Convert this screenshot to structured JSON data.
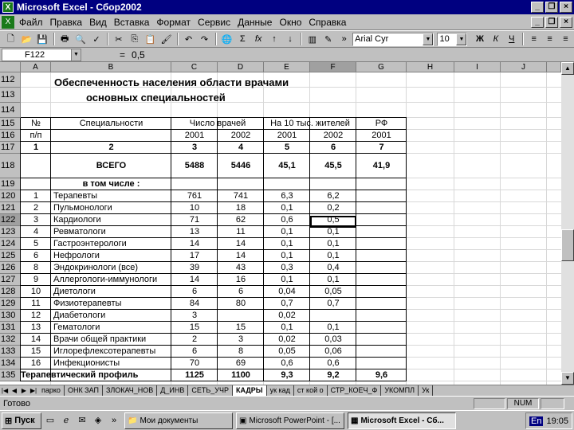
{
  "window": {
    "title": "Microsoft Excel - Сбор2002",
    "excel_icon_label": "X"
  },
  "menu": [
    "Файл",
    "Правка",
    "Вид",
    "Вставка",
    "Формат",
    "Сервис",
    "Данные",
    "Окно",
    "Справка"
  ],
  "toolbar": {
    "font": "Arial Cyr",
    "size": "10"
  },
  "formula": {
    "cell_ref": "F122",
    "eq": "=",
    "value": "0,5"
  },
  "columns": [
    "A",
    "B",
    "C",
    "D",
    "E",
    "F",
    "G",
    "H",
    "I",
    "J"
  ],
  "rows": [
    "112",
    "113",
    "114",
    "115",
    "116",
    "117",
    "118",
    "119",
    "120",
    "121",
    "122",
    "123",
    "124",
    "125",
    "126",
    "127",
    "128",
    "129",
    "130",
    "131",
    "132",
    "133",
    "134",
    "135"
  ],
  "title1": "Обеспеченность населения области врачами",
  "title2": "основных специальностей",
  "header": {
    "no": "№",
    "pp": "п/п",
    "spec": "Специальности",
    "count": "Число врачей",
    "per10k": "На 10 тыс. жителей",
    "rf": "РФ",
    "y2001": "2001",
    "y2002": "2002"
  },
  "colnums": [
    "1",
    "2",
    "3",
    "4",
    "5",
    "6",
    "7"
  ],
  "total": {
    "label": "ВСЕГО",
    "c2001": "5488",
    "c2002": "5446",
    "r2001": "45,1",
    "r2002": "45,5",
    "rf": "41,9"
  },
  "sublabel": "в том числе :",
  "table": [
    {
      "n": "1",
      "name": "Терапевты",
      "a": "761",
      "b": "741",
      "c": "6,3",
      "d": "6,2"
    },
    {
      "n": "2",
      "name": "Пульмонологи",
      "a": "10",
      "b": "18",
      "c": "0,1",
      "d": "0,2"
    },
    {
      "n": "3",
      "name": "Кардиологи",
      "a": "71",
      "b": "62",
      "c": "0,6",
      "d": "0,5"
    },
    {
      "n": "4",
      "name": "Ревматологи",
      "a": "13",
      "b": "11",
      "c": "0,1",
      "d": "0,1"
    },
    {
      "n": "5",
      "name": "Гастроэнтерологи",
      "a": "14",
      "b": "14",
      "c": "0,1",
      "d": "0,1"
    },
    {
      "n": "6",
      "name": "Нефрологи",
      "a": "17",
      "b": "14",
      "c": "0,1",
      "d": "0,1"
    },
    {
      "n": "8",
      "name": "Эндокринологи (все)",
      "a": "39",
      "b": "43",
      "c": "0,3",
      "d": "0,4"
    },
    {
      "n": "9",
      "name": "Аллергологи-иммунологи",
      "a": "14",
      "b": "16",
      "c": "0,1",
      "d": "0,1"
    },
    {
      "n": "10",
      "name": "Диетологи",
      "a": "6",
      "b": "6",
      "c": "0,04",
      "d": "0,05"
    },
    {
      "n": "11",
      "name": "Физиотерапевты",
      "a": "84",
      "b": "80",
      "c": "0,7",
      "d": "0,7"
    },
    {
      "n": "12",
      "name": "Диабетологи",
      "a": "3",
      "b": "",
      "c": "0,02",
      "d": ""
    },
    {
      "n": "13",
      "name": "Гематологи",
      "a": "15",
      "b": "15",
      "c": "0,1",
      "d": "0,1"
    },
    {
      "n": "14",
      "name": "Врачи общей практики",
      "a": "2",
      "b": "3",
      "c": "0,02",
      "d": "0,03"
    },
    {
      "n": "15",
      "name": "Иглорефлексотерапевты",
      "a": "6",
      "b": "8",
      "c": "0,05",
      "d": "0,06"
    },
    {
      "n": "16",
      "name": "Инфекционисты",
      "a": "70",
      "b": "69",
      "c": "0,6",
      "d": "0,6"
    }
  ],
  "last": {
    "name": "Терапевтический профиль",
    "a": "1125",
    "b": "1100",
    "c": "9,3",
    "d": "9,2",
    "e": "9,6"
  },
  "tabs": [
    "парко",
    "ОНК ЗАП",
    "ЗЛОКАЧ_НОВ",
    "Д_ИНВ",
    "СЕТЬ_УЧР",
    "КАДРЫ",
    "ук кад",
    "ст кой о",
    "СТР_КОЕЧ_Ф",
    "УКОМПЛ",
    "Ук"
  ],
  "status": {
    "ready": "Готово",
    "num": "NUM"
  },
  "taskbar": {
    "start": "Пуск",
    "tasks": [
      "Мои документы",
      "Microsoft PowerPoint - [...",
      "Microsoft Excel - Сб..."
    ],
    "lang": "En",
    "clock": "19:05"
  }
}
